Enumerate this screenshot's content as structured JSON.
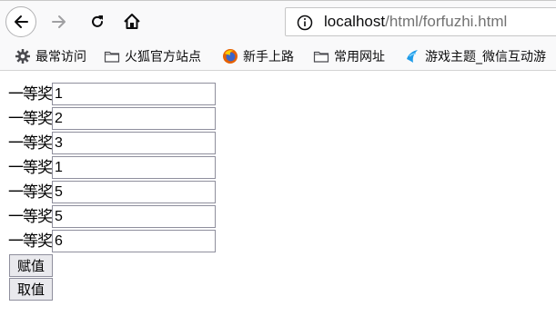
{
  "browser": {
    "url_host": "localhost",
    "url_path": "/html/forfuzhi.html"
  },
  "bookmarks": [
    {
      "label": "最常访问",
      "icon": "gear-icon"
    },
    {
      "label": "火狐官方站点",
      "icon": "folder-icon"
    },
    {
      "label": "新手上路",
      "icon": "firefox-icon"
    },
    {
      "label": "常用网址",
      "icon": "folder-icon"
    },
    {
      "label": "游戏主题_微信互动游",
      "icon": "game-icon"
    }
  ],
  "form": {
    "rows": [
      {
        "label": "一等奖",
        "value": "1"
      },
      {
        "label": "一等奖",
        "value": "2"
      },
      {
        "label": "一等奖",
        "value": "3"
      },
      {
        "label": "一等奖",
        "value": "1"
      },
      {
        "label": "一等奖",
        "value": "5"
      },
      {
        "label": "一等奖",
        "value": "5"
      },
      {
        "label": "一等奖",
        "value": "6"
      }
    ],
    "assign_label": "赋值",
    "get_label": "取值"
  }
}
